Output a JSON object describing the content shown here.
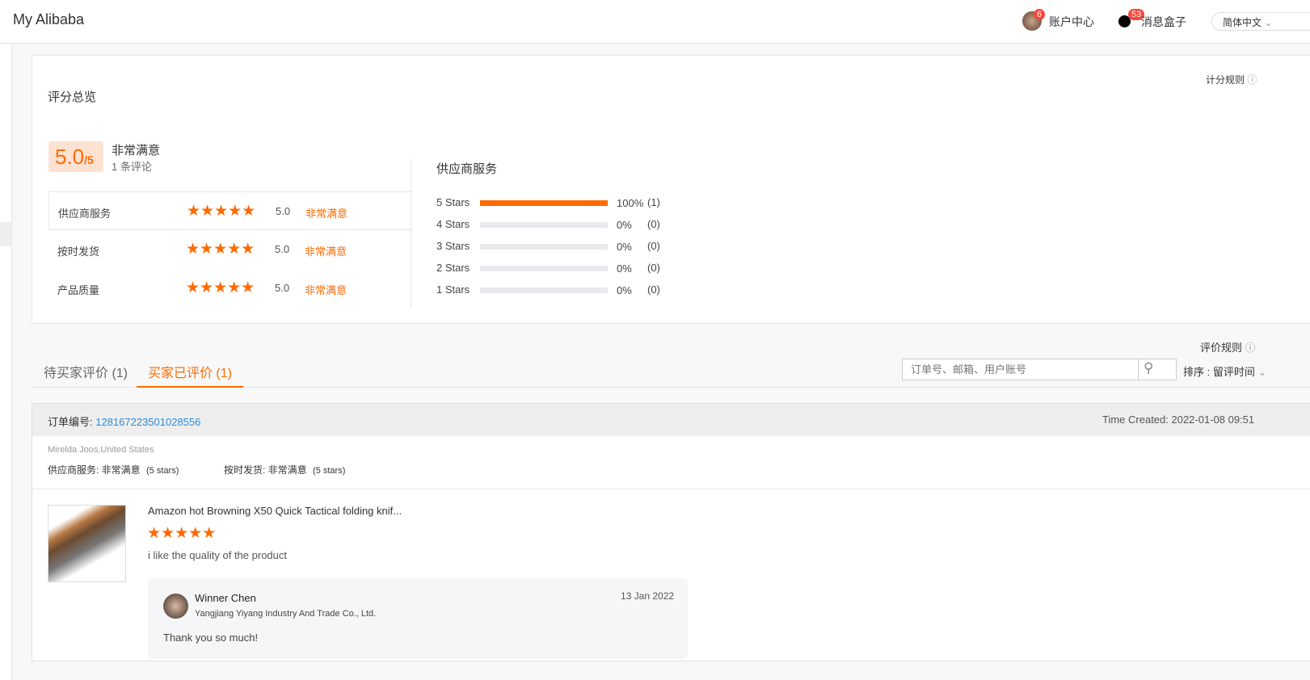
{
  "header": {
    "title": "My Alibaba",
    "account_label": "账户中心",
    "account_badge": "6",
    "messages_label": "消息盒子",
    "messages_badge": "53",
    "language": "简体中文"
  },
  "overview": {
    "title": "评分总览",
    "rules_link": "计分规则",
    "score": "5.0",
    "score_max": "/5",
    "score_text": "非常满意",
    "review_count": "1 条评论",
    "categories": [
      {
        "label": "供应商服务",
        "stars": 5,
        "score": "5.0",
        "text": "非常满意"
      },
      {
        "label": "按时发货",
        "stars": 5,
        "score": "5.0",
        "text": "非常满意"
      },
      {
        "label": "产品质量",
        "stars": 5,
        "score": "5.0",
        "text": "非常满意"
      }
    ],
    "breakdown_title": "供应商服务",
    "breakdown": [
      {
        "label": "5 Stars",
        "percent": 100,
        "percent_text": "100%",
        "count": "(1)"
      },
      {
        "label": "4 Stars",
        "percent": 0,
        "percent_text": "0%",
        "count": "(0)"
      },
      {
        "label": "3 Stars",
        "percent": 0,
        "percent_text": "0%",
        "count": "(0)"
      },
      {
        "label": "2 Stars",
        "percent": 0,
        "percent_text": "0%",
        "count": "(0)"
      },
      {
        "label": "1 Stars",
        "percent": 0,
        "percent_text": "0%",
        "count": "(0)"
      }
    ]
  },
  "reviews": {
    "rules_link": "评价规则",
    "tabs": [
      "待买家评价 (1)",
      "买家已评价 (1)"
    ],
    "active_tab": 1,
    "search_placeholder": "订单号、邮箱、用户账号",
    "sort_label": "排序 : 留评时间"
  },
  "order": {
    "number_label": "订单编号: ",
    "number": "128167223501028556",
    "created": "Time Created: 2022-01-08 09:51",
    "buyer": "Mirelda Joos,United States",
    "rating1_label": "供应商服务: ",
    "rating1_value": "非常满意",
    "rating1_stars": "(5 stars)",
    "rating2_label": "按时发货: ",
    "rating2_value": "非常满意",
    "rating2_stars": "(5 stars)",
    "product_title": "Amazon hot Browning X50 Quick Tactical folding knif...",
    "product_stars": 5,
    "comment": "i like the quality of the product",
    "reply": {
      "name": "Winner Chen",
      "company": "Yangjiang Yiyang Industry And Trade Co., Ltd.",
      "date": "13 Jan 2022",
      "text": "Thank you so much!"
    }
  },
  "colors": {
    "accent": "#ff6a00",
    "link": "#2f8bd6"
  }
}
